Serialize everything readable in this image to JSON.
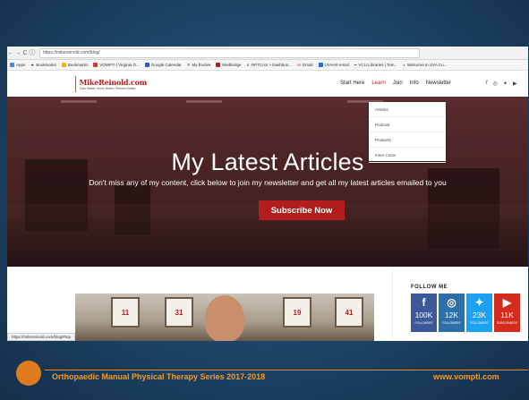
{
  "browser": {
    "url": "https://mikereinold.com/blog/",
    "bookmarks": [
      "Apps",
      "Bookmarks",
      "Bookmarks",
      "VOMPTI | Virginia O...",
      "Google Calendar",
      "My Evolve",
      "Medbridge",
      "RPTCAS > Dashboo...",
      "Gmail",
      "UVAHS email",
      "VCU Libraries | Tom...",
      "Welcome to UVA Co..."
    ]
  },
  "site": {
    "brand": "MikeReinold.com",
    "tagline": "Train Better. Move Better. Perform Better.",
    "nav": [
      "Start Here",
      "Learn",
      "Join",
      "Info",
      "Newsletter"
    ],
    "dropdown": [
      "Articles",
      "Podcast",
      "Products",
      "Inner Circle"
    ]
  },
  "hero": {
    "title": "My Latest Articles",
    "subtitle": "Don't miss any of my content, click below to join my newsletter and get all my latest articles emailed to you",
    "cta": "Subscribe Now"
  },
  "jerseys": [
    "11",
    "31",
    "19",
    "41"
  ],
  "status_url": "https://mikereinold.com/blog/#top",
  "follow": {
    "title": "FOLLOW ME",
    "tiles": [
      {
        "icon": "f",
        "count": "100K",
        "label": "FOLLOWERS",
        "color": "#3b5998"
      },
      {
        "icon": "◎",
        "count": "12K",
        "label": "FOLLOWERS",
        "color": "#2f6fa8"
      },
      {
        "icon": "✦",
        "count": "23K",
        "label": "FOLLOWERS",
        "color": "#1da1f2"
      },
      {
        "icon": "▶",
        "count": "11K",
        "label": "SUBSCRIBERS",
        "color": "#d62b1f"
      }
    ]
  },
  "slide_footer": {
    "title": "Orthopaedic Manual Physical Therapy Series 2017-2018",
    "url": "www.vompti.com"
  }
}
